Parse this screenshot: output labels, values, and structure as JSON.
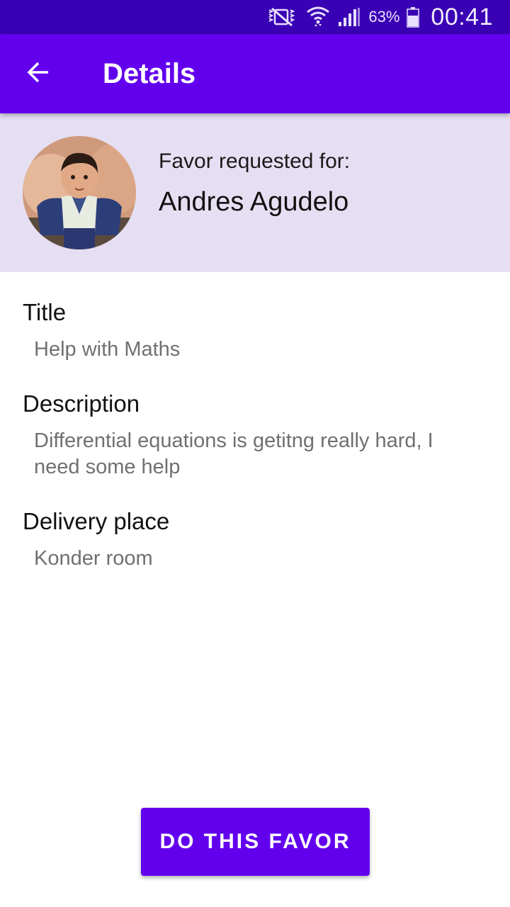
{
  "status_bar": {
    "battery_percent": "63%",
    "time": "00:41",
    "icons": [
      "vibrate-mute-icon",
      "wifi-icon",
      "signal-icon",
      "battery-icon"
    ]
  },
  "app_bar": {
    "title": "Details",
    "back_icon": "arrow-back-icon"
  },
  "requester": {
    "label": "Favor requested for:",
    "name": "Andres Agudelo"
  },
  "fields": {
    "title": {
      "label": "Title",
      "value": "Help with Maths"
    },
    "description": {
      "label": "Description",
      "value": "Differential equations is getitng really hard, I need some help"
    },
    "delivery": {
      "label": "Delivery place",
      "value": "Konder room"
    }
  },
  "actions": {
    "primary_label": "DO THIS FAVOR"
  },
  "colors": {
    "status_bar": "#3a00b4",
    "primary": "#6200ee",
    "header_bg": "#e6dff3"
  }
}
